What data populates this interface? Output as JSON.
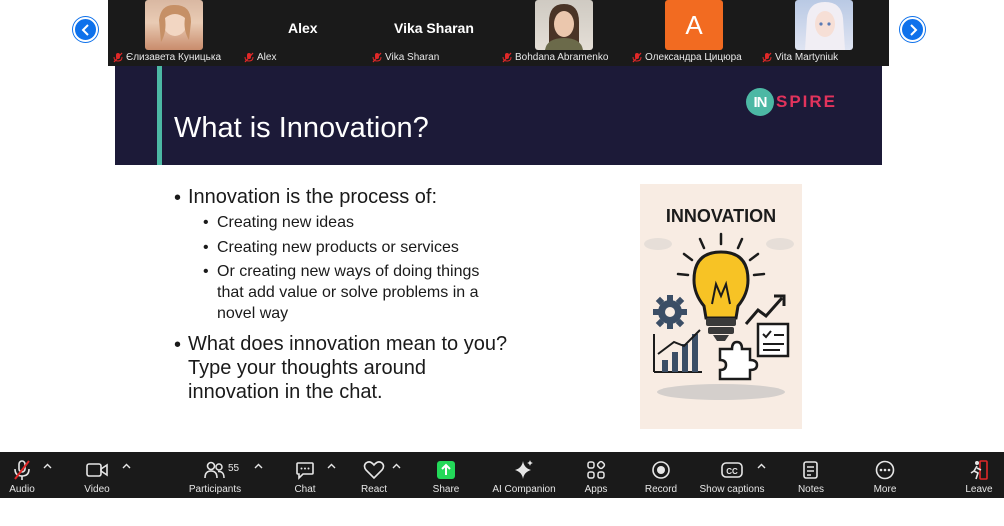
{
  "participants": {
    "tiles": [
      {
        "name": "Єлизавета Куницька",
        "type": "photo"
      },
      {
        "name": "Alex",
        "type": "name",
        "display": "Alex"
      },
      {
        "name": "Vika Sharan",
        "type": "name",
        "display": "Vika Sharan"
      },
      {
        "name": "Bohdana Abramenko",
        "type": "photo"
      },
      {
        "name": "Олександра Цицюра",
        "type": "initial",
        "initial": "A",
        "color": "#f26b21"
      },
      {
        "name": "Vita Martyniuk",
        "type": "photo"
      }
    ]
  },
  "slide": {
    "title": "What is Innovation?",
    "logo": {
      "first": "IN",
      "rest": "SPIRE"
    },
    "bullets": [
      {
        "text": "Innovation is the process of:"
      },
      {
        "text": "Creating new ideas"
      },
      {
        "text": "Creating new products or services"
      },
      {
        "text": "Or creating new ways of doing things"
      },
      {
        "text": "that add value or solve problems in a"
      },
      {
        "text": "novel way"
      },
      {
        "text": "What does innovation mean to you?"
      },
      {
        "text": "Type your thoughts around"
      },
      {
        "text": "innovation in the chat."
      }
    ],
    "illustration_title": "INNOVATION"
  },
  "toolbar": {
    "audio": "Audio",
    "video": "Video",
    "participants": "Participants",
    "participant_count": "55",
    "chat": "Chat",
    "react": "React",
    "share": "Share",
    "ai_companion": "AI Companion",
    "apps": "Apps",
    "record": "Record",
    "show_captions": "Show captions",
    "notes": "Notes",
    "more": "More",
    "leave": "Leave"
  },
  "colors": {
    "accent_blue": "#0e71eb",
    "share_green": "#23d959",
    "leave_red": "#e02828",
    "slide_header": "#1c1a38",
    "teal": "#4cb8a4",
    "logo_pink": "#e2335c"
  }
}
